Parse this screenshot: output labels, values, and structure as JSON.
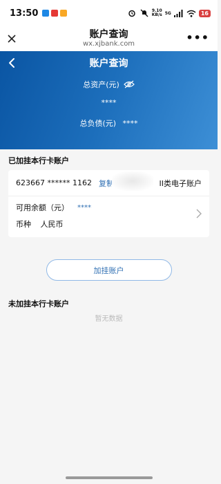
{
  "status_bar": {
    "time": "13:50",
    "net_speed_top": "9.10",
    "net_speed_bottom": "KB/s",
    "network": "5G",
    "battery": "16"
  },
  "miniapp": {
    "title": "账户查询",
    "url": "wx.xjbank.com"
  },
  "header": {
    "title": "账户查询",
    "total_assets_label": "总资产(元)",
    "total_assets_value": "****",
    "total_debt_label": "总负债(元)",
    "total_debt_value": "****"
  },
  "bound_section": {
    "title": "已加挂本行卡账户",
    "account": {
      "number": "623667 ****** 1162",
      "copy_label": "复制",
      "type": "II类电子账户",
      "balance_label": "可用余额（元）",
      "balance_value": "****",
      "currency_label": "币种",
      "currency_value": "人民币"
    },
    "add_button": "加挂账户"
  },
  "unbound_section": {
    "title": "未加挂本行卡账户",
    "empty": "暂无数据"
  },
  "colors": {
    "accent": "#2f6fb3",
    "header_gradient_start": "#0a55a3",
    "header_gradient_end": "#3d8fd6"
  }
}
